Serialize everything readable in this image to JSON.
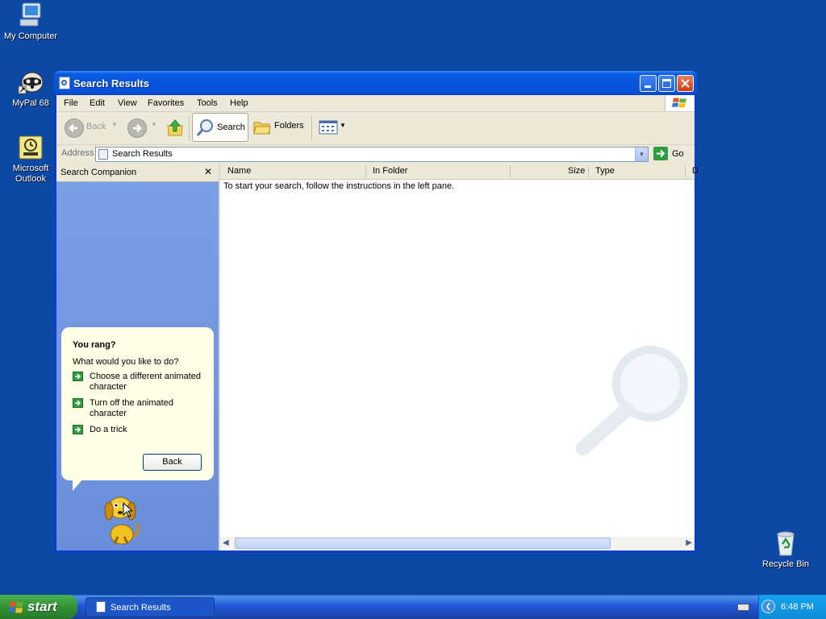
{
  "desktop": {
    "icons": [
      {
        "label": "My Computer"
      },
      {
        "label": "MyPal 68"
      },
      {
        "label": "Microsoft Outlook"
      },
      {
        "label": "Recycle Bin"
      }
    ]
  },
  "window": {
    "title": "Search Results",
    "menu": [
      "File",
      "Edit",
      "View",
      "Favorites",
      "Tools",
      "Help"
    ],
    "toolbar": {
      "back_label": "Back",
      "search_label": "Search",
      "folders_label": "Folders"
    },
    "address": {
      "label": "Address",
      "value": "Search Results",
      "go_label": "Go"
    },
    "search_companion": {
      "title": "Search Companion",
      "close_glyph": "✕"
    },
    "columns": [
      "Name",
      "In Folder",
      "Size",
      "Type",
      "D"
    ],
    "empty_message": "To start your search, follow the instructions in the left pane.",
    "bubble": {
      "heading": "You rang?",
      "question": "What would you like to do?",
      "options": [
        "Choose a different animated character",
        "Turn off the animated character",
        "Do a trick"
      ],
      "back_button": "Back"
    }
  },
  "taskbar": {
    "start_label": "start",
    "task_label": "Search Results",
    "clock": "6:48 PM"
  },
  "colors": {
    "desktop": "#0d48a3",
    "titlebar": "#0654d9",
    "start_green": "#318f33",
    "tray": "#0f8cd8"
  }
}
